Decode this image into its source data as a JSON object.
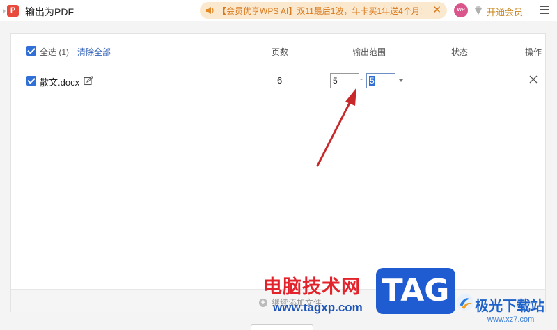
{
  "window": {
    "title": "输出为PDF",
    "logo_glyph": "P"
  },
  "promo": {
    "text": "【会员优享WPS AI】双11最后1波，年卡买1年送4个月!",
    "close_glyph": "✕"
  },
  "account": {
    "avatar_text": "WP",
    "vip_label": "开通会员"
  },
  "table": {
    "select_all_label": "全选 (1)",
    "clear_all_label": "清除全部",
    "columns": {
      "pages": "页数",
      "range": "输出范围",
      "status": "状态",
      "action": "操作"
    },
    "rows": [
      {
        "file_name": "散文.docx",
        "pages": "6",
        "range_from": "5",
        "range_to": "5",
        "status": ""
      }
    ]
  },
  "footer": {
    "add_file_label": "继续添加文件",
    "add_icon_glyph": "+"
  },
  "range_separator": "-",
  "watermarks": {
    "site_cn": "电脑技术网",
    "site_url": "www.tagxp.com",
    "tag": "TAG",
    "jg_name": "极光下载站",
    "jg_url": "www.xz7.com"
  },
  "colors": {
    "accent": "#2f6fd6",
    "promo_bg": "#fbe9cf",
    "promo_text": "#d9781a",
    "annotation_arrow": "#c8282a",
    "app_logo": "#e84a3c"
  }
}
